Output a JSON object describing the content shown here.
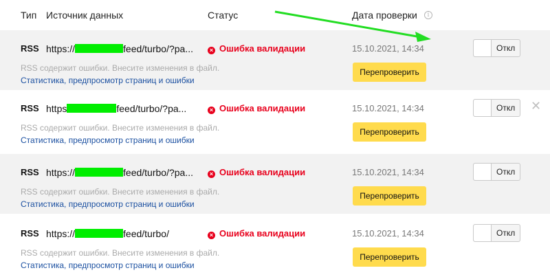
{
  "columns": {
    "type": "Тип",
    "source": "Источник данных",
    "status": "Статус",
    "date": "Дата проверки",
    "info_icon": "info-icon"
  },
  "rows": [
    {
      "type": "RSS",
      "url_prefix": "https://",
      "url_suffix": "feed/turbo/?pa...",
      "status": "Ошибка валидации",
      "date": "15.10.2021, 14:34",
      "description": "RSS содержит ошибки. Внесите изменения в файл.",
      "link": "Статистика, предпросмотр страниц и ошибки",
      "recheck_label": "Перепроверить",
      "toggle_label": "Откл"
    },
    {
      "type": "RSS",
      "url_prefix": "https",
      "url_suffix": "feed/turbo/?pa...",
      "status": "Ошибка валидации",
      "date": "15.10.2021, 14:34",
      "description": "RSS содержит ошибки. Внесите изменения в файл.",
      "link": "Статистика, предпросмотр страниц и ошибки",
      "recheck_label": "Перепроверить",
      "toggle_label": "Откл"
    },
    {
      "type": "RSS",
      "url_prefix": "https://",
      "url_suffix": "feed/turbo/?pa...",
      "status": "Ошибка валидации",
      "date": "15.10.2021, 14:34",
      "description": "RSS содержит ошибки. Внесите изменения в файл.",
      "link": "Статистика, предпросмотр страниц и ошибки",
      "recheck_label": "Перепроверить",
      "toggle_label": "Откл"
    },
    {
      "type": "RSS",
      "url_prefix": "https://",
      "url_suffix": "feed/turbo/",
      "status": "Ошибка валидации",
      "date": "15.10.2021, 14:34",
      "description": "RSS содержит ошибки. Внесите изменения в файл.",
      "link": "Статистика, предпросмотр страниц и ошибки",
      "recheck_label": "Перепроверить",
      "toggle_label": "Откл"
    }
  ],
  "colors": {
    "error": "#e8001c",
    "button": "#ffdb4d",
    "link": "#1a4fa0",
    "redaction": "#00ee00",
    "annotation_arrow": "#22dd22",
    "row_shade": "#f2f2f2"
  },
  "icons": {
    "error": "error-circle-icon",
    "close": "close-icon"
  }
}
